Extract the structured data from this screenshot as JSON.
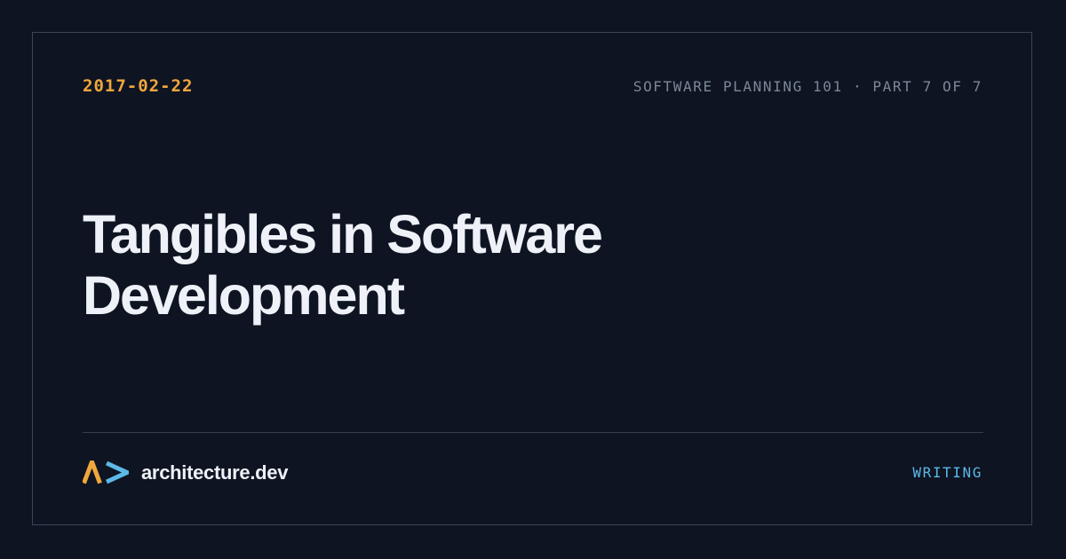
{
  "card": {
    "date": "2017-02-22",
    "series": "SOFTWARE PLANNING 101 · PART 7 OF 7",
    "title": "Tangibles in Software Development",
    "site": "architecture.dev",
    "category": "WRITING"
  },
  "logo": {
    "icon": "chevron-arrow-icon",
    "colors": {
      "chevron": "#f0a73c",
      "arrow": "#5cb8e6"
    }
  },
  "colors": {
    "background": "#0e1422",
    "frame_border": "#3a4556",
    "date_accent": "#f0a73c",
    "series_text": "#7c8797",
    "title_text": "#eef1f7",
    "category_accent": "#5cb8e6"
  }
}
